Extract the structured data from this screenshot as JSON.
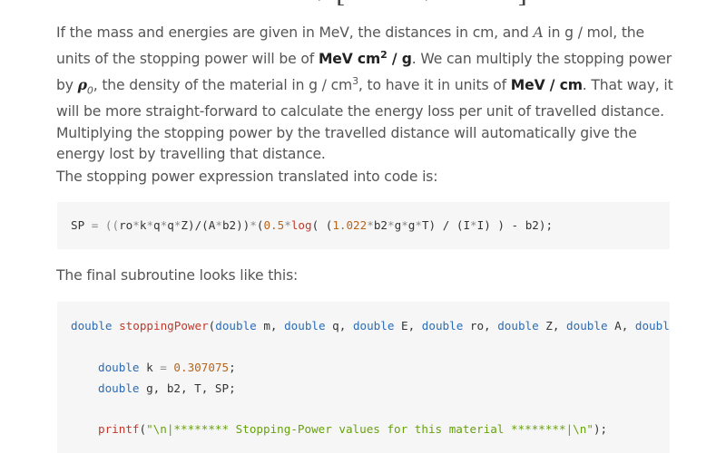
{
  "formula_fragment": {
    "left_symbol": "=",
    "mid_symbol": "β",
    "right_symbol": "β",
    "bracket_open": "[",
    "bracket_close": "]"
  },
  "paragraph1": {
    "t1": "If the mass and energies are given in MeV, the distances in cm, and ",
    "var_A": "A",
    "t2": " in g / mol, the units of the stopping power will be of ",
    "unit1_a": "MeV cm",
    "unit1_sup": "2",
    "unit1_b": " / g",
    "t3": ". We can multiply the stopping power by ",
    "rho": "ρ",
    "rho_sub": "0",
    "t4": ", the density of the material in g / cm",
    "cm_sup": "3",
    "t5": ", to have it in units of ",
    "unit2": "MeV / cm",
    "t6": ". That way, it will be more straight-forward to calculate the energy loss per unit of travelled distance. Multiplying the stopping power by the travelled distance will automatically give the energy lost by travelling that distance."
  },
  "paragraph2": "The stopping power expression translated into code is:",
  "code1": {
    "a": "SP ",
    "b": "= ((",
    "c": "ro",
    "d": "*",
    "e": "k",
    "f": "*",
    "g": "q",
    "h": "*",
    "i": "q",
    "j": "*",
    "k": "Z)/(A",
    "l": "*",
    "m": "b2))",
    "n": "*",
    "o": "(",
    "p": "0.5",
    "q": "*",
    "r": "log",
    "s": "( (",
    "t": "1.022",
    "u": "*",
    "v": "b2",
    "w": "*",
    "x": "g",
    "y": "*",
    "z": "g",
    "aa": "*",
    "ab": "T) / (I",
    "ac": "*",
    "ad": "I) ) - b2);"
  },
  "paragraph3": "The final subroutine looks like this:",
  "code2": {
    "line1": {
      "kw1": "double",
      "fn": " stoppingPower",
      "p1": "(",
      "kw2": "double",
      "v1": " m, ",
      "kw3": "double",
      "v2": " q, ",
      "kw4": "double",
      "v3": " E, ",
      "kw5": "double",
      "v4": " ro, ",
      "kw6": "double",
      "v5": " Z, ",
      "kw7": "double",
      "v6": " A, ",
      "kw8": "double"
    },
    "line2": {
      "kw": "double",
      "a": " k ",
      "op": "=",
      "num": " 0.307075",
      "b": ";"
    },
    "line3": {
      "kw": "double",
      "a": " g, b2, T, SP;"
    },
    "line4": {
      "fn": "printf",
      "p": "(",
      "str": "\"\\n|******** Stopping-Power values for this material ********|\\n\"",
      "end": ");"
    }
  }
}
